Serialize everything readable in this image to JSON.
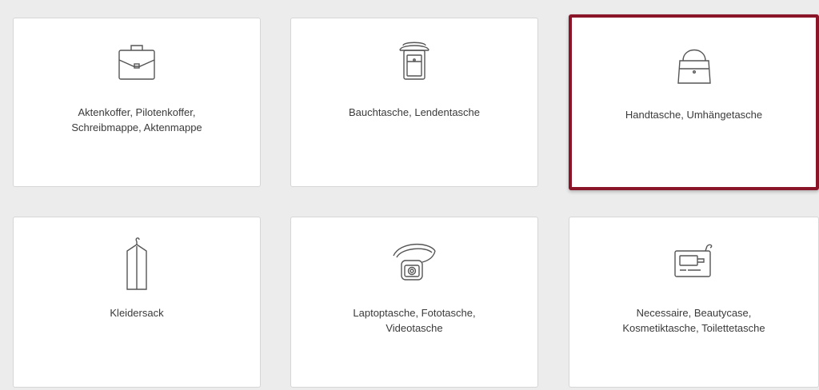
{
  "accent_color": "#8a1528",
  "categories": [
    {
      "icon": "briefcase-icon",
      "lines": [
        "Aktenkoffer, Pilotenkoffer,",
        "Schreibmappe, Aktenmappe"
      ],
      "selected": false
    },
    {
      "icon": "belt-bag-icon",
      "lines": [
        "Bauchtasche, Lendentasche"
      ],
      "selected": false
    },
    {
      "icon": "handbag-icon",
      "lines": [
        "Handtasche, Umhängetasche"
      ],
      "selected": true
    },
    {
      "icon": "garment-bag-icon",
      "lines": [
        "Kleidersack"
      ],
      "selected": false
    },
    {
      "icon": "camera-bag-icon",
      "lines": [
        "Laptoptasche, Fototasche,",
        "Videotasche"
      ],
      "selected": false
    },
    {
      "icon": "toiletry-bag-icon",
      "lines": [
        "Necessaire, Beautycase,",
        "Kosmetiktasche, Toilettetasche"
      ],
      "selected": false
    }
  ]
}
